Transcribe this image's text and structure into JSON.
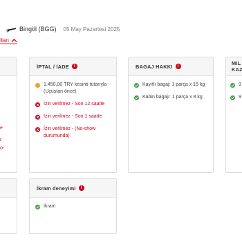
{
  "route": {
    "destination": "Bingöl (BGG)",
    "date": "05 May Pazartesi 2025"
  },
  "toggle": {
    "label": "ılları"
  },
  "colors": {
    "accent": "#d0021b",
    "ok": "#4aa14a",
    "coin": "#e8a33a"
  },
  "cards": {
    "refund": {
      "title": "İPTAL / İADE",
      "rows": [
        {
          "icon": "coin-icon",
          "text": "1.450,00 TRY kesinti tutarıyla - (Uçuştan önce)",
          "style": "dark"
        },
        {
          "icon": "cross-icon",
          "text": "İzin verilmez - Son 12 saatte",
          "style": "red"
        },
        {
          "icon": "cross-icon",
          "text": "İzin verilmez - Son 1 saatte",
          "style": "red"
        },
        {
          "icon": "cross-icon",
          "text": "İzin verilmez - (No-show durumunda)",
          "style": "red"
        }
      ]
    },
    "baggage": {
      "title": "BAGAJ HAKKI",
      "rows": [
        {
          "icon": "check-icon",
          "text": "Kayıtlı bagaj: 1 parça x 15 kg"
        },
        {
          "icon": "check-icon",
          "text": "Kabin bagajı: 1 parça x 8 kg"
        }
      ]
    },
    "miles": {
      "title_line1": "MIL",
      "title_line2": "KAZ",
      "rows": [
        "9",
        "9"
      ]
    },
    "catering": {
      "title": "İkram deneyimi",
      "rows": [
        {
          "icon": "check-icon",
          "text": "İkram"
        }
      ]
    }
  },
  "left_fragments": [
    "e",
    "r",
    "o-"
  ]
}
